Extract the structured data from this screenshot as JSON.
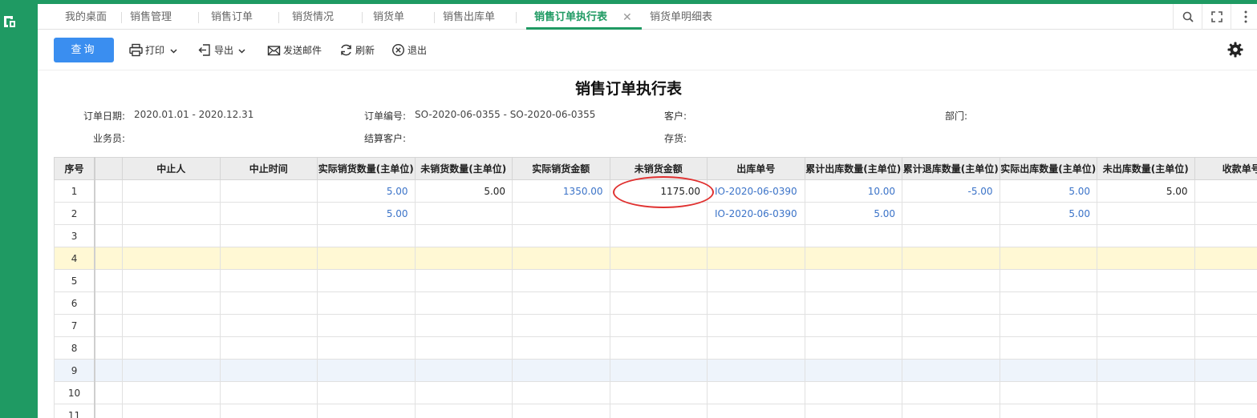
{
  "tabs": [
    {
      "label": "我的桌面"
    },
    {
      "label": "销售管理"
    },
    {
      "label": "销售订单"
    },
    {
      "label": "销货情况"
    },
    {
      "label": "销货单"
    },
    {
      "label": "销售出库单"
    },
    {
      "label": "销售订单执行表",
      "active": true
    },
    {
      "label": "销货单明细表"
    }
  ],
  "tab_close": "✕",
  "toolbar": {
    "query": "查询",
    "print": "打印",
    "export": "导出",
    "email": "发送邮件",
    "refresh": "刷新",
    "exit": "退出"
  },
  "report": {
    "title": "销售订单执行表",
    "fields": {
      "order_date_label": "订单日期:",
      "order_date_value": "2020.01.01 - 2020.12.31",
      "order_no_label": "订单编号:",
      "order_no_value": "SO-2020-06-0355 - SO-2020-06-0355",
      "customer_label": "客户:",
      "dept_label": "部门:",
      "salesman_label": "业务员:",
      "settle_customer_label": "结算客户:",
      "inventory_label": "存货:"
    }
  },
  "table": {
    "columns": [
      "序号",
      "",
      "中止人",
      "中止时间",
      "实际销货数量(主单位)",
      "未销货数量(主单位)",
      "实际销货金额",
      "未销货金额",
      "出库单号",
      "累计出库数量(主单位)",
      "累计退库数量(主单位)",
      "实际出库数量(主单位)",
      "未出库数量(主单位)",
      "收款单号"
    ],
    "rows": [
      {
        "seq": "1",
        "actual_qty": "5.00",
        "unsold_qty": "5.00",
        "actual_amt": "1350.00",
        "unsold_amt": "1175.00",
        "out_no": "IO-2020-06-0390",
        "cum_out": "10.00",
        "cum_return": "-5.00",
        "actual_out": "5.00",
        "not_out": "5.00"
      },
      {
        "seq": "2",
        "actual_qty": "5.00",
        "unsold_qty": "",
        "actual_amt": "",
        "unsold_amt": "",
        "out_no": "IO-2020-06-0390",
        "cum_out": "5.00",
        "cum_return": "",
        "actual_out": "5.00",
        "not_out": ""
      },
      {
        "seq": "3"
      },
      {
        "seq": "4"
      },
      {
        "seq": "5"
      },
      {
        "seq": "6"
      },
      {
        "seq": "7"
      },
      {
        "seq": "8"
      },
      {
        "seq": "9"
      },
      {
        "seq": "10"
      },
      {
        "seq": "11"
      }
    ]
  },
  "colors": {
    "brand_green": "#1f9a63",
    "query_blue": "#3a8ef0",
    "link_blue": "#3b73c8",
    "highlight_yellow": "#fff8d4",
    "annotation_red": "#e0302f"
  },
  "icons": {
    "logo": "app-logo-icon",
    "search": "search-icon",
    "fullscreen": "fullscreen-icon",
    "more": "more-vertical-icon",
    "print": "printer-icon",
    "export": "export-icon",
    "email": "email-icon",
    "refresh": "refresh-icon",
    "exit": "close-circle-icon",
    "settings": "gear-icon"
  }
}
